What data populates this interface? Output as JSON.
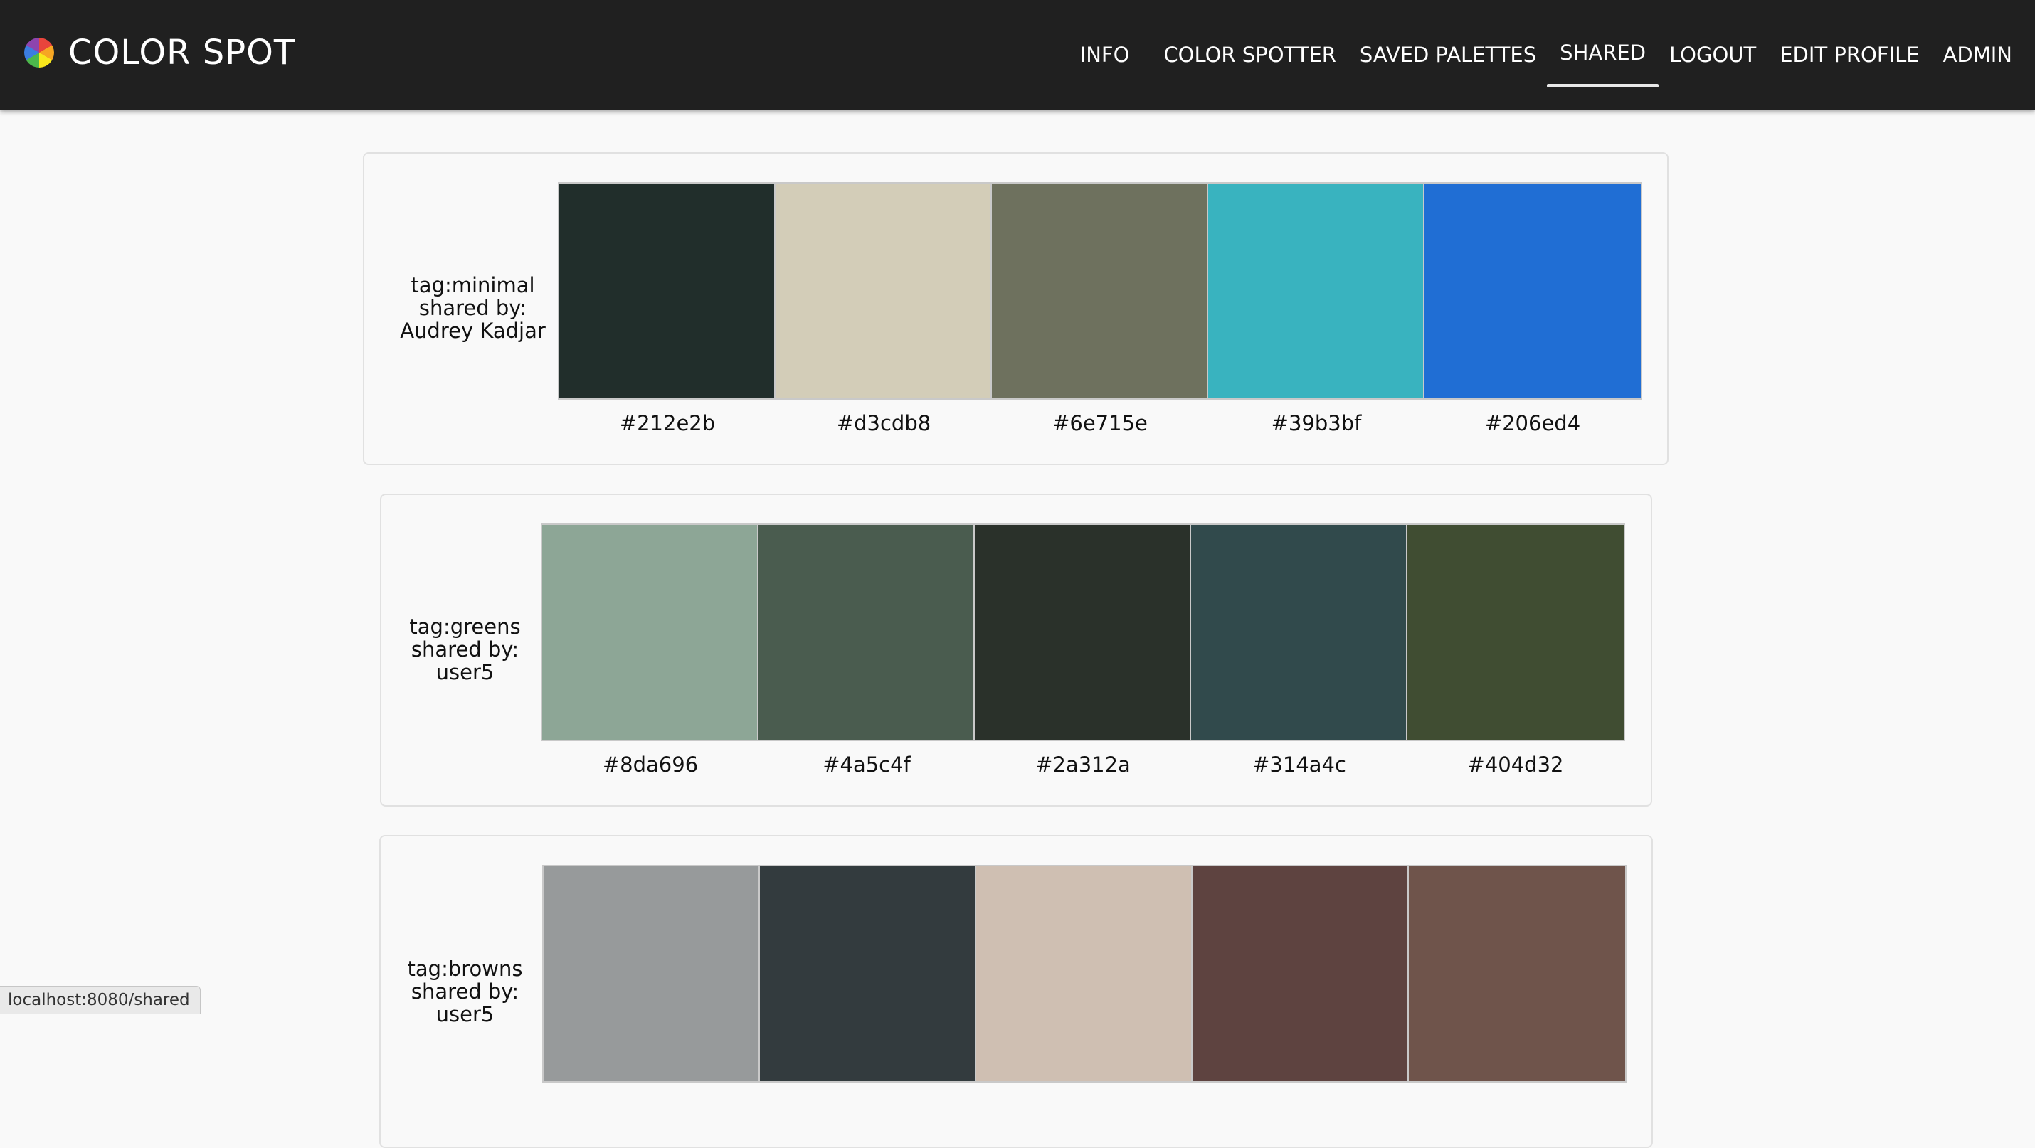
{
  "brand": {
    "title": "COLOR SPOT"
  },
  "nav": {
    "items": [
      {
        "label": "INFO"
      },
      {
        "label": "COLOR SPOTTER"
      },
      {
        "label": "SAVED PALETTES"
      },
      {
        "label": "SHARED"
      },
      {
        "label": "LOGOUT"
      },
      {
        "label": "EDIT PROFILE"
      },
      {
        "label": "ADMIN"
      }
    ],
    "active": "SHARED"
  },
  "palettes": [
    {
      "tag": "tag:minimal",
      "shared_by_label": "shared by:",
      "user": "Audrey Kadjar",
      "colors": [
        "#212e2b",
        "#d3cdb8",
        "#6e715e",
        "#39b3bf",
        "#206ed4"
      ],
      "hexes": [
        "#212e2b",
        "#d3cdb8",
        "#6e715e",
        "#39b3bf",
        "#206ed4"
      ]
    },
    {
      "tag": "tag:greens",
      "shared_by_label": "shared by:",
      "user": "user5",
      "colors": [
        "#8da696",
        "#4a5c4f",
        "#2a312a",
        "#314a4c",
        "#404d32"
      ],
      "hexes": [
        "#8da696",
        "#4a5c4f",
        "#2a312a",
        "#314a4c",
        "#404d32"
      ]
    },
    {
      "tag": "tag:browns",
      "shared_by_label": "shared by:",
      "user": "user5",
      "colors": [
        "#979a9b",
        "#333b3e",
        "#cfbfb2",
        "#5e4340",
        "#6f544b"
      ],
      "hexes": []
    }
  ],
  "status_bar": {
    "url": "localhost:8080/shared"
  }
}
